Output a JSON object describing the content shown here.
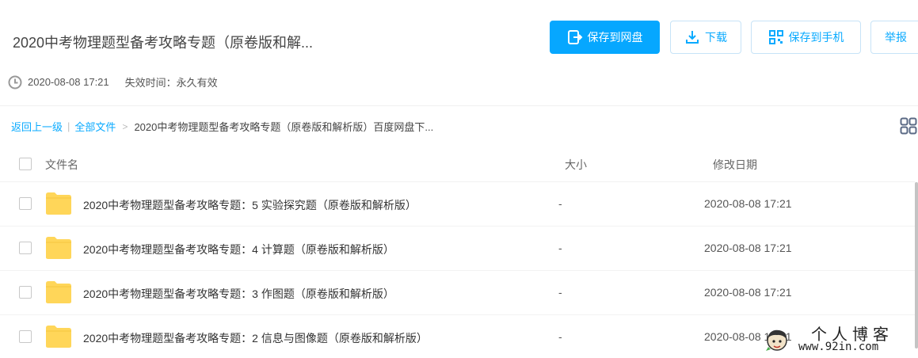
{
  "header": {
    "title": "2020中考物理题型备考攻略专题（原卷版和解...",
    "buttons": {
      "save": "保存到网盘",
      "download": "下载",
      "save_phone": "保存到手机",
      "report": "举报"
    }
  },
  "meta": {
    "date": "2020-08-08 17:21",
    "expire_label": "失效时间：",
    "expire_value": "永久有效"
  },
  "breadcrumb": {
    "back": "返回上一级",
    "separator": "|",
    "all_files": "全部文件",
    "arrow": ">",
    "current": "2020中考物理题型备考攻略专题（原卷版和解析版）百度网盘下..."
  },
  "table": {
    "columns": {
      "name": "文件名",
      "size": "大小",
      "date": "修改日期"
    },
    "rows": [
      {
        "name": "2020中考物理题型备考攻略专题：5 实验探究题（原卷版和解析版）",
        "size": "-",
        "date": "2020-08-08 17:21"
      },
      {
        "name": "2020中考物理题型备考攻略专题：4 计算题（原卷版和解析版）",
        "size": "-",
        "date": "2020-08-08 17:21"
      },
      {
        "name": "2020中考物理题型备考攻略专题：3 作图题（原卷版和解析版）",
        "size": "-",
        "date": "2020-08-08 17:21"
      },
      {
        "name": "2020中考物理题型备考攻略专题：2 信息与图像题（原卷版和解析版）",
        "size": "-",
        "date": "2020-08-08 17:21"
      }
    ]
  },
  "watermark": {
    "title": "个人博客",
    "url": "www.92in.com"
  },
  "colors": {
    "accent": "#06a7ff",
    "link": "#09aaff",
    "folder": "#ffd659"
  },
  "icons": {
    "save": "save-to-disk-icon",
    "download": "download-icon",
    "phone": "qr-phone-icon",
    "clock": "clock-icon",
    "grid": "grid-view-icon",
    "folder": "folder-icon"
  }
}
